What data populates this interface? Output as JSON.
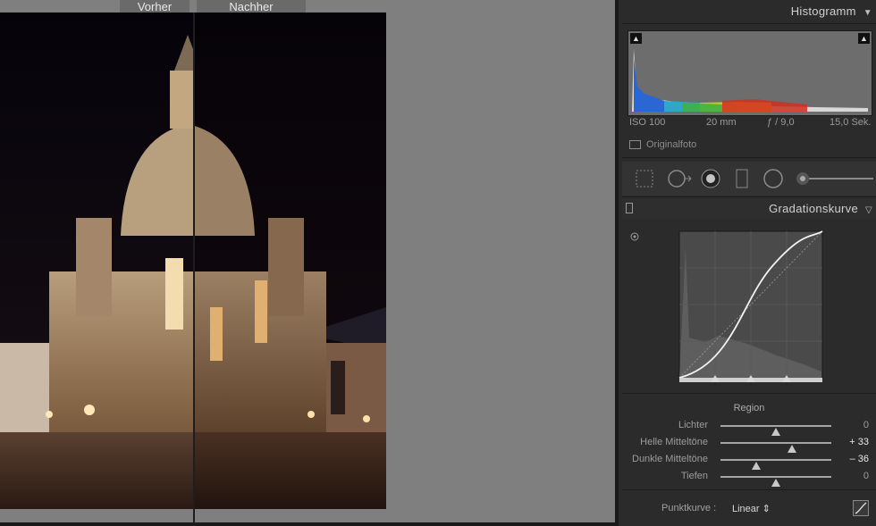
{
  "compare": {
    "before_label": "Vorher",
    "after_label": "Nachher"
  },
  "histogram": {
    "title": "Histogramm",
    "iso": "ISO 100",
    "focal": "20 mm",
    "aperture": "ƒ / 9,0",
    "shutter": "15,0 Sek.",
    "original_label": "Originalfoto"
  },
  "curve_panel": {
    "title": "Gradationskurve",
    "region_label": "Region",
    "sliders": [
      {
        "label": "Lichter",
        "value": "0",
        "level": 0
      },
      {
        "label": "Helle Mitteltöne",
        "value": "+ 33",
        "level": 33
      },
      {
        "label": "Dunkle Mitteltöne",
        "value": "– 36",
        "level": -36
      },
      {
        "label": "Tiefen",
        "value": "0",
        "level": 0
      }
    ],
    "point_curve_label": "Punktkurve :",
    "point_curve_value": "Linear ⇕"
  }
}
